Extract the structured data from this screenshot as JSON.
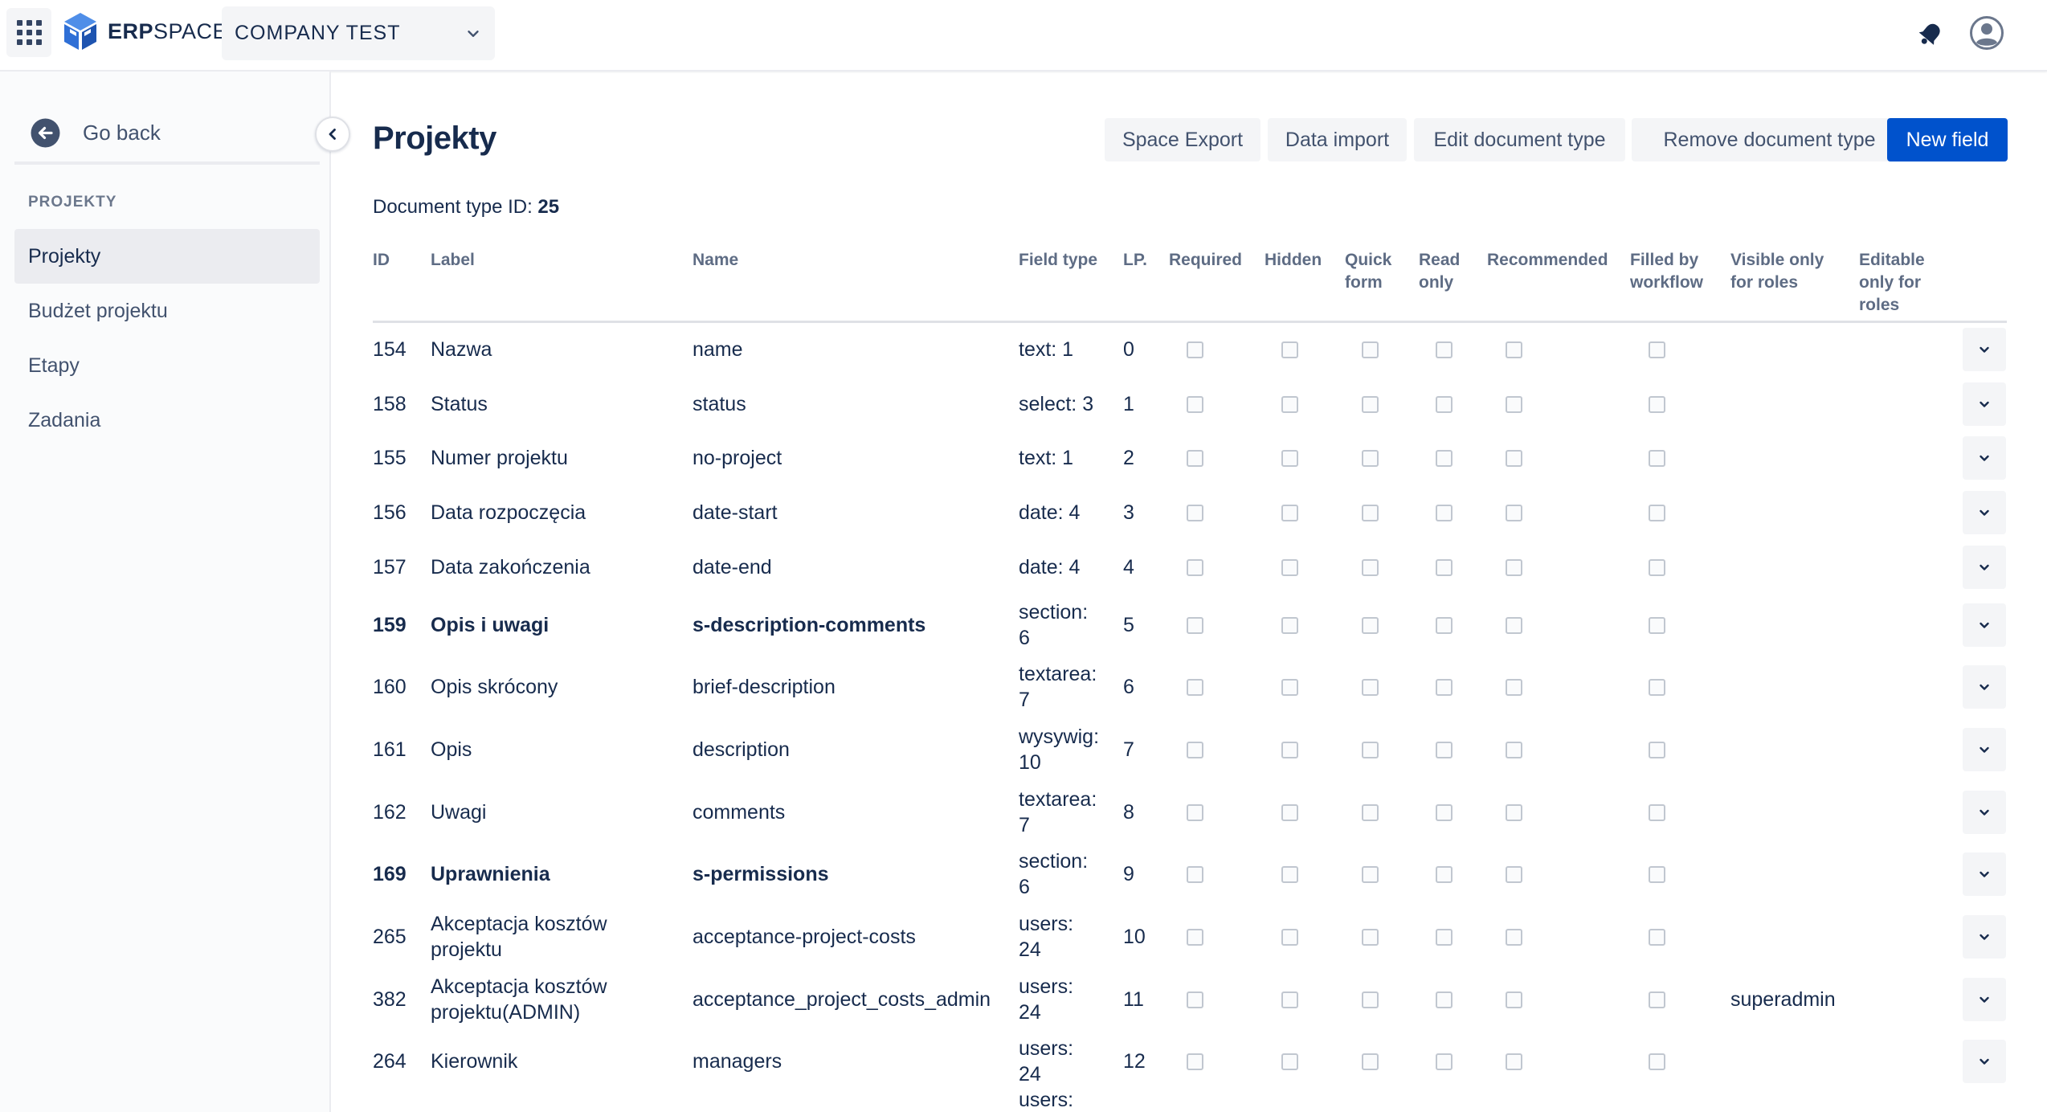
{
  "header": {
    "logo_bold": "ERP",
    "logo_light": "SPACE",
    "company": "COMPANY TEST"
  },
  "sidebar": {
    "go_back": "Go back",
    "section_title": "PROJEKTY",
    "items": [
      {
        "label": "Projekty",
        "active": true
      },
      {
        "label": "Budżet projektu",
        "active": false
      },
      {
        "label": "Etapy",
        "active": false
      },
      {
        "label": "Zadania",
        "active": false
      }
    ]
  },
  "main": {
    "title": "Projekty",
    "buttons": {
      "space_export": "Space Export",
      "data_import": "Data import",
      "edit_doc_type": "Edit document type",
      "remove_doc_type": "Remove document type",
      "new_field": "New field"
    },
    "doc_type_label": "Document type ID:",
    "doc_type_id": "25"
  },
  "table": {
    "headers": {
      "id": "ID",
      "label": "Label",
      "name": "Name",
      "field_type": "Field type",
      "lp": "LP.",
      "required": "Required",
      "hidden": "Hidden",
      "quick_form_1": "Quick",
      "quick_form_2": "form",
      "read_only_1": "Read",
      "read_only_2": "only",
      "recommended": "Recommended",
      "filled_1": "Filled by",
      "filled_2": "workflow",
      "visible_1": "Visible only",
      "visible_2": "for roles",
      "editable_1": "Editable",
      "editable_2": "only for",
      "editable_3": "roles"
    },
    "rows": [
      {
        "id": "154",
        "label1": "Nazwa",
        "label2": "",
        "name": "name",
        "type1": "text: 1",
        "type2": "",
        "lp": "0",
        "visible_roles": "",
        "bold": false
      },
      {
        "id": "158",
        "label1": "Status",
        "label2": "",
        "name": "status",
        "type1": "select: 3",
        "type2": "",
        "lp": "1",
        "visible_roles": "",
        "bold": false
      },
      {
        "id": "155",
        "label1": "Numer projektu",
        "label2": "",
        "name": "no-project",
        "type1": "text: 1",
        "type2": "",
        "lp": "2",
        "visible_roles": "",
        "bold": false
      },
      {
        "id": "156",
        "label1": "Data rozpoczęcia",
        "label2": "",
        "name": "date-start",
        "type1": "date: 4",
        "type2": "",
        "lp": "3",
        "visible_roles": "",
        "bold": false
      },
      {
        "id": "157",
        "label1": "Data zakończenia",
        "label2": "",
        "name": "date-end",
        "type1": "date: 4",
        "type2": "",
        "lp": "4",
        "visible_roles": "",
        "bold": false
      },
      {
        "id": "159",
        "label1": "Opis i uwagi",
        "label2": "",
        "name": "s-description-comments",
        "type1": "section:",
        "type2": "6",
        "lp": "5",
        "visible_roles": "",
        "bold": true
      },
      {
        "id": "160",
        "label1": "Opis skrócony",
        "label2": "",
        "name": "brief-description",
        "type1": "textarea:",
        "type2": "7",
        "lp": "6",
        "visible_roles": "",
        "bold": false
      },
      {
        "id": "161",
        "label1": "Opis",
        "label2": "",
        "name": "description",
        "type1": "wysywig:",
        "type2": "10",
        "lp": "7",
        "visible_roles": "",
        "bold": false
      },
      {
        "id": "162",
        "label1": "Uwagi",
        "label2": "",
        "name": "comments",
        "type1": "textarea:",
        "type2": "7",
        "lp": "8",
        "visible_roles": "",
        "bold": false
      },
      {
        "id": "169",
        "label1": "Uprawnienia",
        "label2": "",
        "name": "s-permissions",
        "type1": "section:",
        "type2": "6",
        "lp": "9",
        "visible_roles": "",
        "bold": true
      },
      {
        "id": "265",
        "label1": "Akceptacja kosztów",
        "label2": "projektu",
        "name": "acceptance-project-costs",
        "type1": "users:",
        "type2": "24",
        "lp": "10",
        "visible_roles": "",
        "bold": false
      },
      {
        "id": "382",
        "label1": "Akceptacja kosztów",
        "label2": "projektu(ADMIN)",
        "name": "acceptance_project_costs_admin",
        "type1": "users:",
        "type2": "24",
        "lp": "11",
        "visible_roles": "superadmin",
        "bold": false
      },
      {
        "id": "264",
        "label1": "Kierownik",
        "label2": "",
        "name": "managers",
        "type1": "users:",
        "type2": "24",
        "lp": "12",
        "visible_roles": "",
        "bold": false
      },
      {
        "id": "",
        "label1": "",
        "label2": "",
        "name": "",
        "type1": "users:",
        "type2": "",
        "lp": "",
        "visible_roles": "",
        "bold": false,
        "partial": true
      }
    ]
  },
  "colors": {
    "primary": "#0052cc",
    "logo_blue": "#2f6fd6",
    "sidebar_bg": "#fafbfc",
    "button_bg": "#f4f5f7"
  },
  "icons": [
    "apps-grid-icon",
    "erpspace-logo-icon",
    "chevron-down-icon",
    "bell-icon",
    "user-avatar-icon",
    "arrow-left-circle-icon",
    "chevron-left-icon",
    "expand-chevron-icon"
  ]
}
